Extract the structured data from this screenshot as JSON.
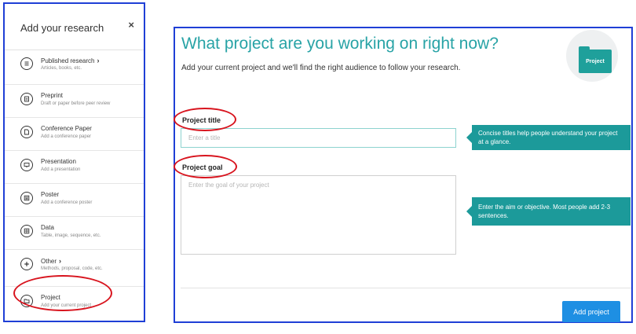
{
  "sidebar": {
    "title": "Add your research",
    "close_symbol": "×",
    "items": [
      {
        "label": "Published research",
        "has_chevron": true,
        "description": "Articles, books, etc.",
        "icon": "document-lines-icon"
      },
      {
        "label": "Preprint",
        "has_chevron": false,
        "description": "Draft or paper before peer review",
        "icon": "preprint-icon"
      },
      {
        "label": "Conference Paper",
        "has_chevron": false,
        "description": "Add a conference paper",
        "icon": "conference-paper-icon"
      },
      {
        "label": "Presentation",
        "has_chevron": false,
        "description": "Add a presentation",
        "icon": "presentation-icon"
      },
      {
        "label": "Poster",
        "has_chevron": false,
        "description": "Add a conference poster",
        "icon": "poster-icon"
      },
      {
        "label": "Data",
        "has_chevron": false,
        "description": "Table, image, sequence, etc.",
        "icon": "data-icon"
      },
      {
        "label": "Other",
        "has_chevron": true,
        "description": "Methods, proposal, code, etc.",
        "icon": "plus-icon"
      },
      {
        "label": "Project",
        "has_chevron": false,
        "description": "Add your current project",
        "icon": "folder-icon"
      }
    ]
  },
  "main": {
    "heading": "What project are you working on right now?",
    "subtext": "Add your current project and we'll find the right audience to follow your research.",
    "badge_label": "Project",
    "title_field": {
      "label": "Project title",
      "placeholder": "Enter a title",
      "value": ""
    },
    "goal_field": {
      "label": "Project goal",
      "placeholder": "Enter the goal of your project",
      "value": ""
    },
    "tooltip_title": "Concise titles help people understand your project at a glance.",
    "tooltip_goal": "Enter the aim or objective. Most people add 2-3 sentences.",
    "submit_label": "Add project"
  },
  "colors": {
    "accent_teal": "#28a3a6",
    "tooltip_teal": "#1c9a9a",
    "button_blue": "#1e8fe3",
    "highlight_red": "#d8141e",
    "frame_blue": "#1f3fd6"
  }
}
